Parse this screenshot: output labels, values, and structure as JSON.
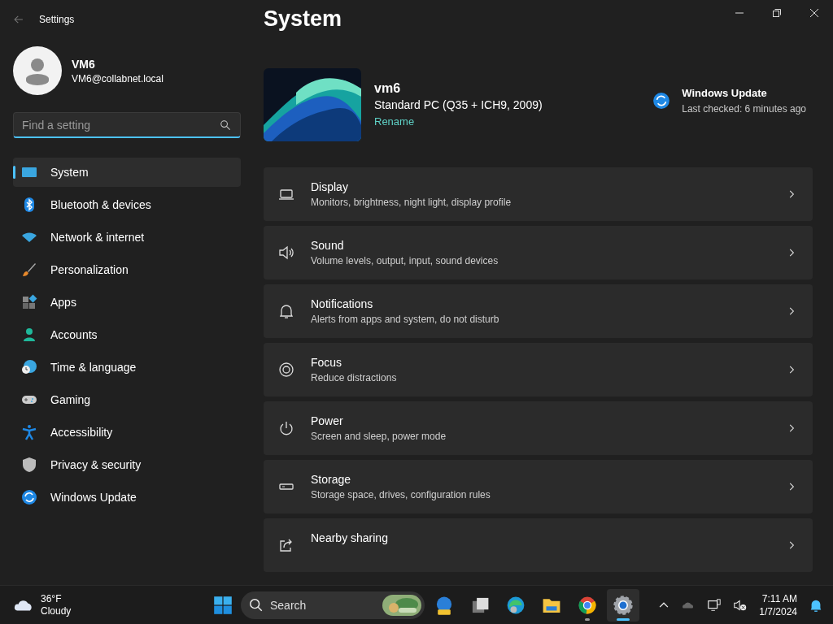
{
  "window": {
    "title": "Settings"
  },
  "account": {
    "name": "VM6",
    "email": "VM6@collabnet.local"
  },
  "search": {
    "placeholder": "Find a setting"
  },
  "sidebar": {
    "items": [
      {
        "label": "System",
        "selected": true
      },
      {
        "label": "Bluetooth & devices",
        "selected": false
      },
      {
        "label": "Network & internet",
        "selected": false
      },
      {
        "label": "Personalization",
        "selected": false
      },
      {
        "label": "Apps",
        "selected": false
      },
      {
        "label": "Accounts",
        "selected": false
      },
      {
        "label": "Time & language",
        "selected": false
      },
      {
        "label": "Gaming",
        "selected": false
      },
      {
        "label": "Accessibility",
        "selected": false
      },
      {
        "label": "Privacy & security",
        "selected": false
      },
      {
        "label": "Windows Update",
        "selected": false
      }
    ]
  },
  "page": {
    "title": "System"
  },
  "device": {
    "name": "vm6",
    "model": "Standard PC (Q35 + ICH9, 2009)",
    "rename": "Rename"
  },
  "update": {
    "title": "Windows Update",
    "status": "Last checked: 6 minutes ago"
  },
  "settings": [
    {
      "title": "Display",
      "description": "Monitors, brightness, night light, display profile"
    },
    {
      "title": "Sound",
      "description": "Volume levels, output, input, sound devices"
    },
    {
      "title": "Notifications",
      "description": "Alerts from apps and system, do not disturb"
    },
    {
      "title": "Focus",
      "description": "Reduce distractions"
    },
    {
      "title": "Power",
      "description": "Screen and sleep, power mode"
    },
    {
      "title": "Storage",
      "description": "Storage space, drives, configuration rules"
    },
    {
      "title": "Nearby sharing"
    }
  ],
  "taskbar": {
    "weather": {
      "temperature": "36°F",
      "condition": "Cloudy"
    },
    "search": {
      "placeholder": "Search"
    },
    "apps": [
      {
        "running": false,
        "selected": false
      },
      {
        "running": false,
        "selected": false
      },
      {
        "running": false,
        "selected": false
      },
      {
        "running": false,
        "selected": false
      },
      {
        "running": true,
        "selected": false
      },
      {
        "running": true,
        "selected": true
      }
    ],
    "time": "7:11 AM",
    "date": "1/7/2024"
  }
}
